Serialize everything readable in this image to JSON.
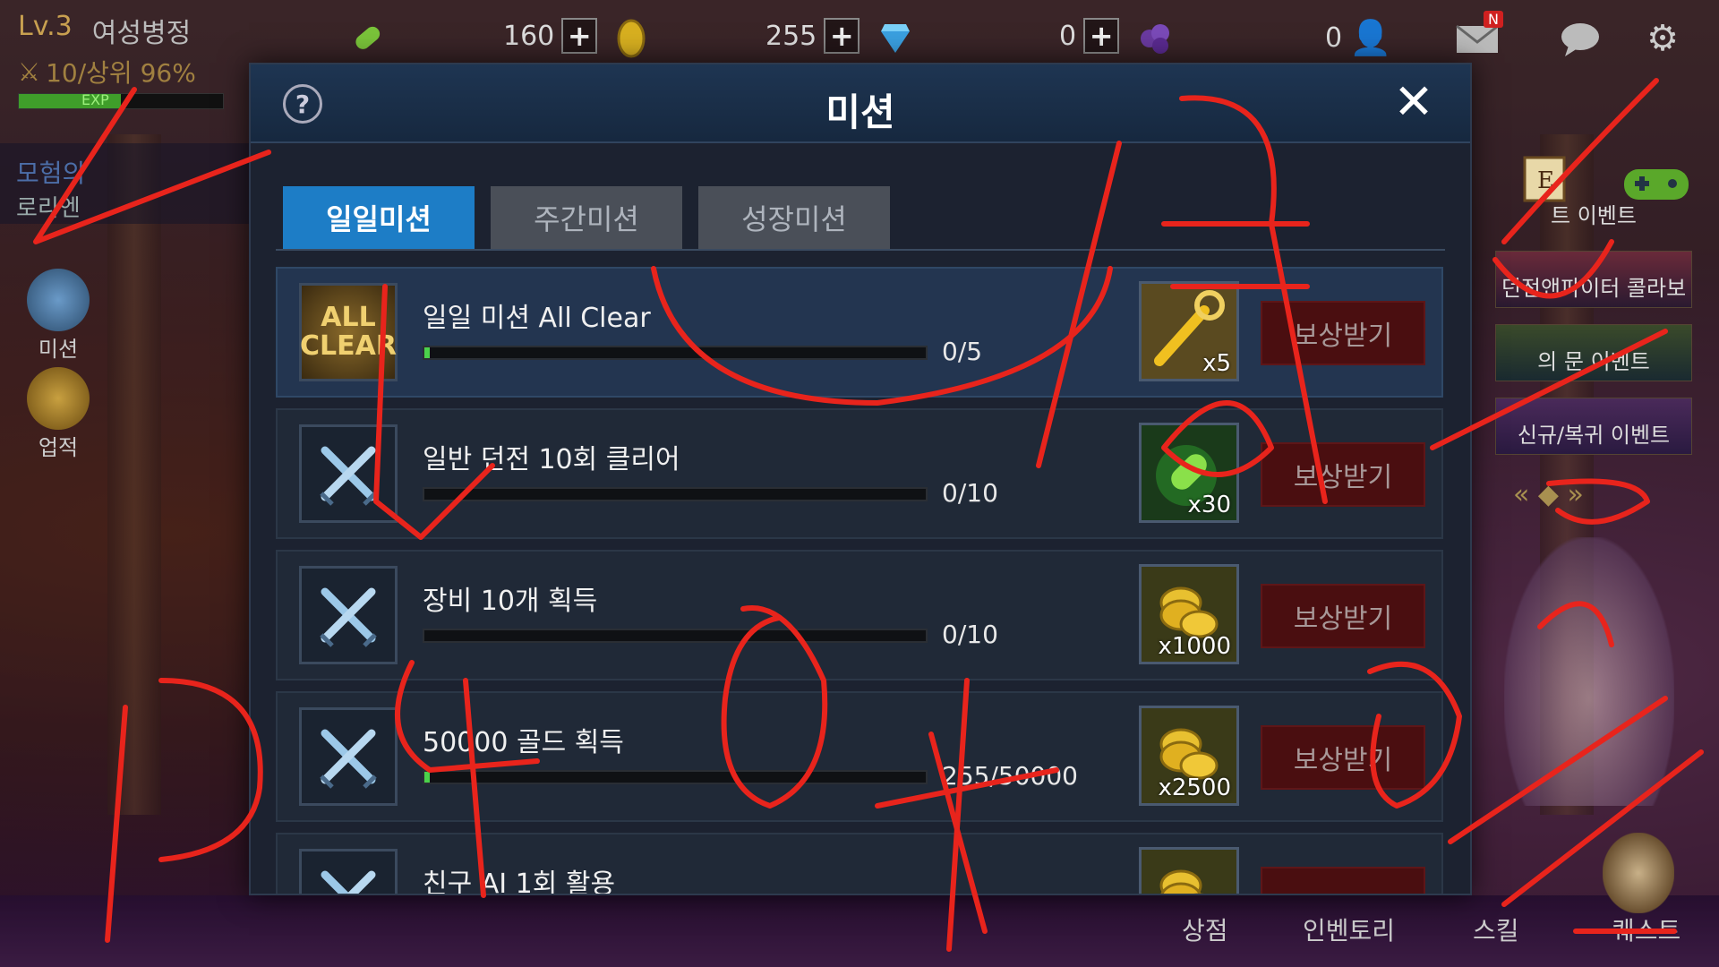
{
  "hud": {
    "level": "Lv.3",
    "job": "여성병정",
    "rank": "10/상위 96%",
    "exp_label": "EXP",
    "exp_fraction": 0.5,
    "stamina": "160",
    "gold": "255",
    "gems": "0",
    "friends": "0",
    "mail_badge": "N"
  },
  "left_menu": {
    "adventure_title": "모험의",
    "adventure_sub": "로리엔",
    "mission_label": "미션",
    "achievement_label": "업적"
  },
  "right_menu": {
    "events": [
      "트 이벤트",
      "던전앤파이터 콜라보",
      "의 문 이벤트",
      "신규/복귀 이벤트"
    ]
  },
  "bottom_menu": {
    "shop": "상점",
    "inventory": "인벤토리",
    "skill": "스킬",
    "quest": "퀘스트"
  },
  "modal": {
    "help": "?",
    "title": "미션",
    "close": "✕",
    "tabs": [
      "일일미션",
      "주간미션",
      "성장미션"
    ]
  },
  "missions": [
    {
      "icon": "all-clear-icon",
      "icon_text": "ALL CLEAR",
      "title": "일일 미션 All Clear",
      "progress": "0/5",
      "fraction": 0.01,
      "reward_icon": "key-icon",
      "reward_count": "x5",
      "claim": "보상받기"
    },
    {
      "icon": "crossed-swords-icon",
      "title": "일반 던전 10회 클리어",
      "progress": "0/10",
      "fraction": 0.0,
      "reward_icon": "stamina-potion-icon",
      "reward_count": "x30",
      "claim": "보상받기"
    },
    {
      "icon": "crossed-swords-icon",
      "title": "장비 10개 획득",
      "progress": "0/10",
      "fraction": 0.0,
      "reward_icon": "gold-coins-icon",
      "reward_count": "x1000",
      "claim": "보상받기"
    },
    {
      "icon": "crossed-swords-icon",
      "title": "50000 골드 획득",
      "progress": "255/50000",
      "fraction": 0.005,
      "reward_icon": "gold-coins-icon",
      "reward_count": "x2500",
      "claim": "보상받기"
    },
    {
      "icon": "crossed-swords-icon",
      "title": "친구 AI 1회 활용",
      "progress": "",
      "fraction": 0.0,
      "reward_icon": "gold-coins-icon",
      "reward_count": "",
      "claim": ""
    }
  ],
  "colors": {
    "tab_active": "#1d7dc6",
    "claim_button": "#4a0e10",
    "scribble": "#e8241c"
  }
}
